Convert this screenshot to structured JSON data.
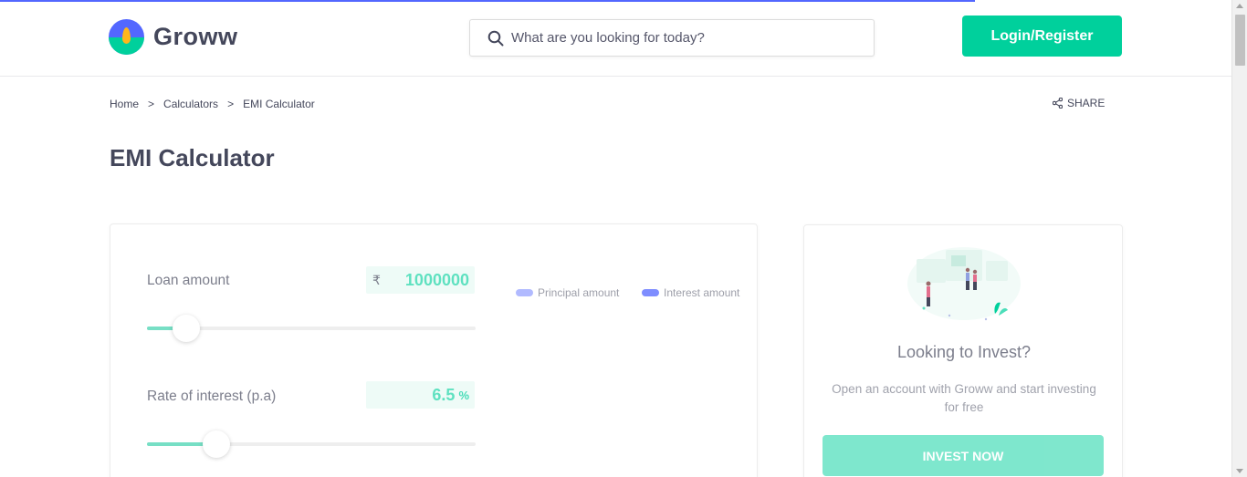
{
  "header": {
    "logo_text": "Groww",
    "search_placeholder": "What are you looking for today?",
    "login_label": "Login/Register"
  },
  "breadcrumb": {
    "items": [
      "Home",
      "Calculators",
      "EMI Calculator"
    ],
    "separator": ">"
  },
  "share_label": "SHARE",
  "page_title": "EMI Calculator",
  "calculator": {
    "loan_amount": {
      "label": "Loan amount",
      "currency_symbol": "₹",
      "value": "1000000",
      "slider_fraction": 0.12
    },
    "rate_of_interest": {
      "label": "Rate of interest (p.a)",
      "value": "6.5",
      "unit": "%",
      "slider_fraction": 0.21
    },
    "legend": [
      {
        "label": "Principal amount",
        "color": "#98a4ff"
      },
      {
        "label": "Interest amount",
        "color": "#5367ff"
      }
    ]
  },
  "invest_card": {
    "title": "Looking to Invest?",
    "description": "Open an account with Groww and start investing for free",
    "button_label": "INVEST NOW",
    "illustration": "people-investing-illustration"
  },
  "colors": {
    "brand_green": "#00d09c",
    "brand_blue": "#5367ff",
    "text_dark": "#44475b"
  }
}
